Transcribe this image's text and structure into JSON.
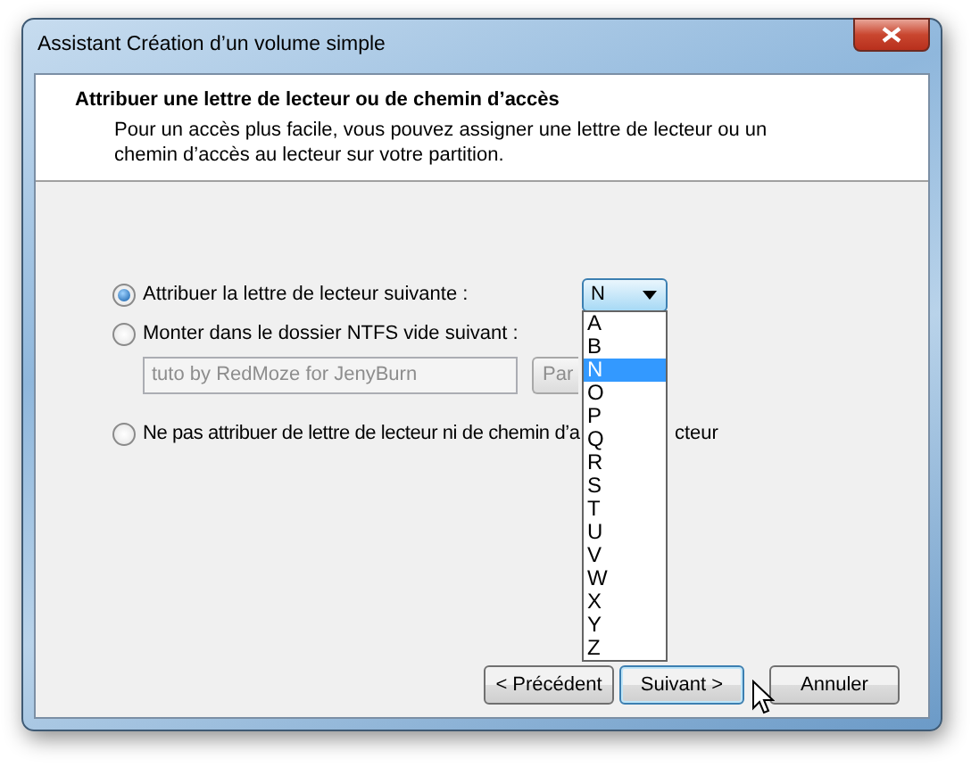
{
  "window": {
    "title": "Assistant Création d’un volume simple"
  },
  "header": {
    "title": "Attribuer une lettre de lecteur ou de chemin d’accès",
    "description": "Pour un accès plus facile, vous pouvez assigner une lettre de lecteur ou un chemin d’accès au lecteur sur votre partition."
  },
  "options": [
    {
      "kind": "letter",
      "label": "Attribuer la lettre de lecteur suivante :",
      "selected": true
    },
    {
      "kind": "folder",
      "label": "Monter dans le dossier NTFS vide suivant :",
      "selected": false
    },
    {
      "kind": "none",
      "label": "Ne pas attribuer de lettre de lecteur ni de chemin d’a",
      "label_tail": "cteur",
      "selected": false
    }
  ],
  "drive_combo": {
    "value": "N",
    "expanded": true,
    "options": [
      {
        "label": "A",
        "selected": false
      },
      {
        "label": "B",
        "selected": false
      },
      {
        "label": "N",
        "selected": true
      },
      {
        "label": "O",
        "selected": false
      },
      {
        "label": "P",
        "selected": false
      },
      {
        "label": "Q",
        "selected": false
      },
      {
        "label": "R",
        "selected": false
      },
      {
        "label": "S",
        "selected": false
      },
      {
        "label": "T",
        "selected": false
      },
      {
        "label": "U",
        "selected": false
      },
      {
        "label": "V",
        "selected": false
      },
      {
        "label": "W",
        "selected": false
      },
      {
        "label": "X",
        "selected": false
      },
      {
        "label": "Y",
        "selected": false
      },
      {
        "label": "Z",
        "selected": false
      }
    ]
  },
  "folder_path": {
    "value": "tuto by RedMoze for JenyBurn",
    "disabled": true
  },
  "browse_button": {
    "label": "Par"
  },
  "buttons": [
    {
      "label": "< Précédent",
      "default": false
    },
    {
      "label": "Suivant >",
      "default": true
    },
    {
      "label": "Annuler",
      "default": false
    }
  ]
}
